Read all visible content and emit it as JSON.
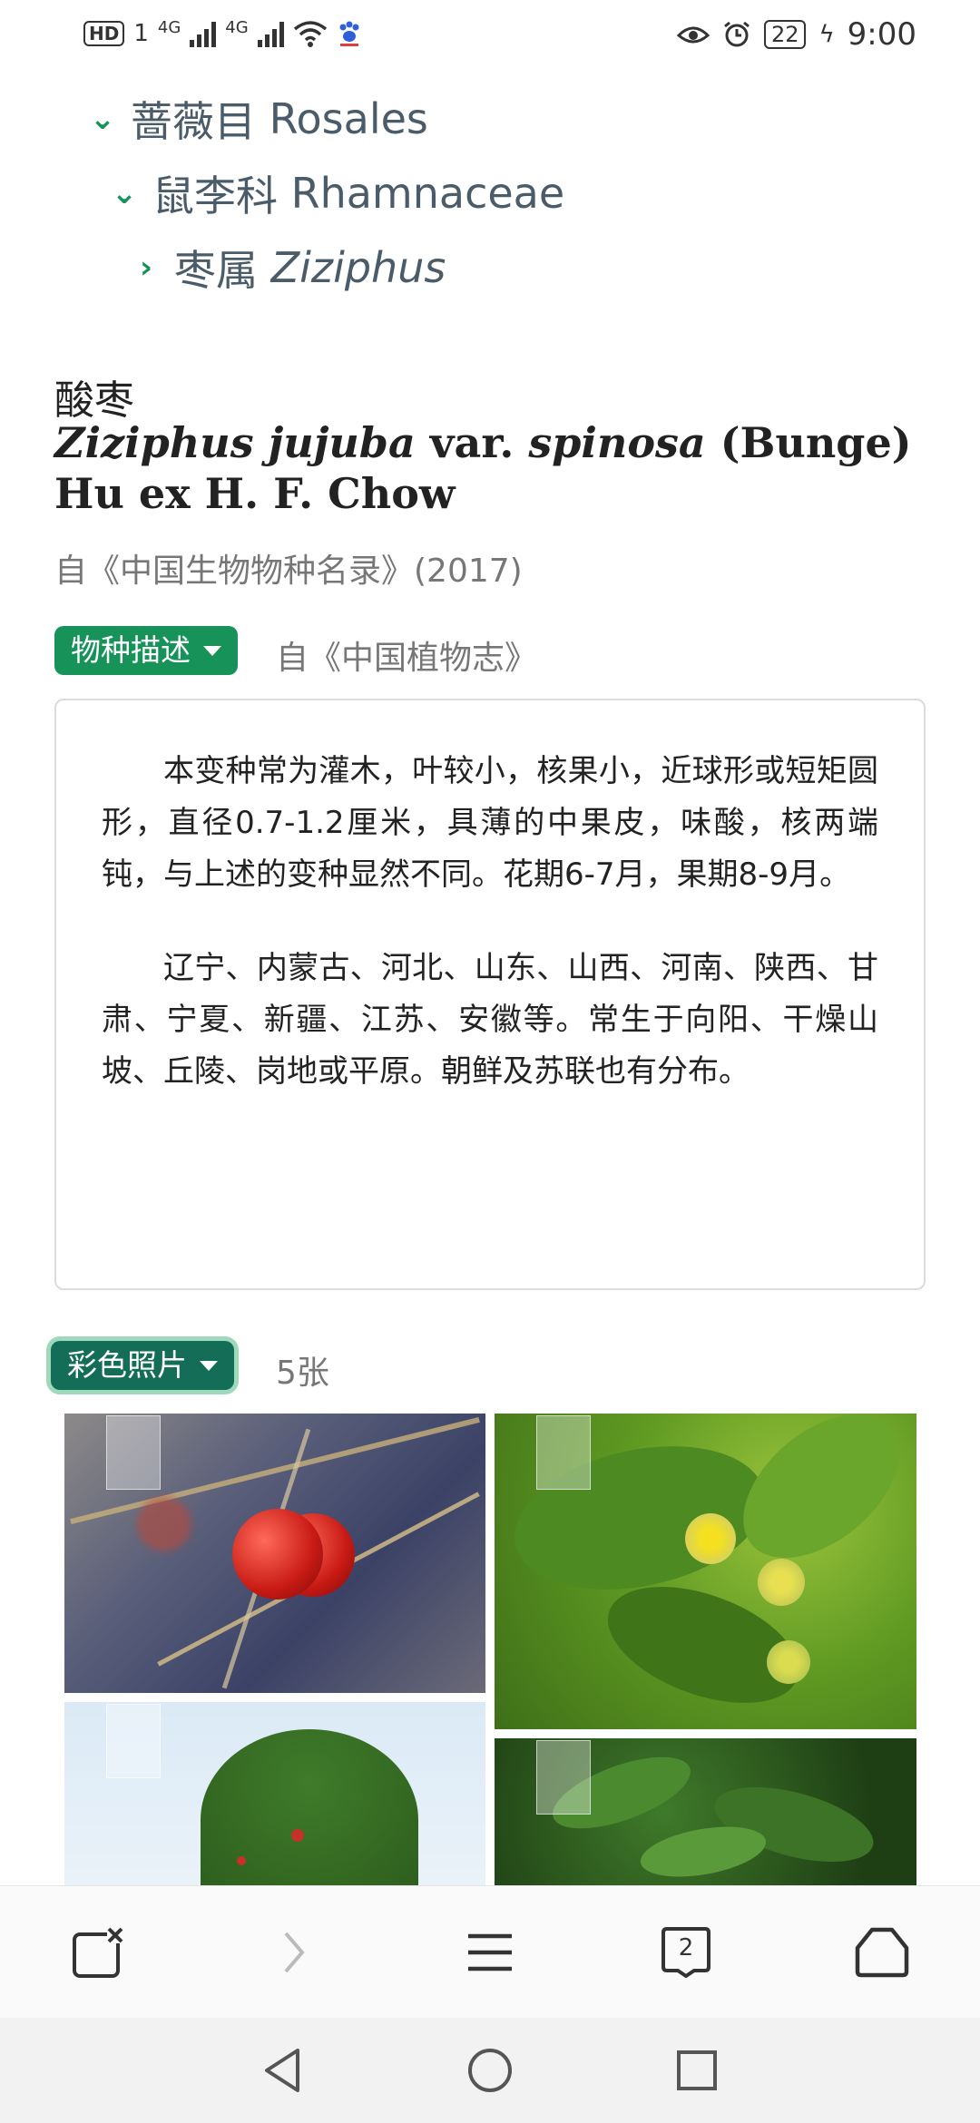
{
  "status_bar": {
    "left_labels": [
      "HD",
      "1",
      "4G",
      "4G"
    ],
    "battery": "22",
    "time": "9:00"
  },
  "taxonomy": [
    {
      "cn": "蔷薇目",
      "latin": "Rosales",
      "expanded": true,
      "italic": false
    },
    {
      "cn": "鼠李科",
      "latin": "Rhamnaceae",
      "expanded": true,
      "italic": false
    },
    {
      "cn": "枣属",
      "latin": "Ziziphus",
      "expanded": false,
      "italic": true
    }
  ],
  "species": {
    "chinese_name": "酸枣",
    "genus": "Ziziphus",
    "epithet": "jujuba",
    "rank": "var.",
    "infra_epithet": "spinosa",
    "authority": "(Bunge) Hu ex H. F. Chow",
    "source": "自《中国生物物种名录》(2017)"
  },
  "description": {
    "button_label": "物种描述",
    "source": "自《中国植物志》",
    "paragraphs": [
      "本变种常为灌木，叶较小，核果小，近球形或短矩圆形，直径0.7-1.2厘米，具薄的中果皮，味酸，核两端钝，与上述的变种显然不同。花期6-7月，果期8-9月。",
      "辽宁、内蒙古、河北、山东、山西、河南、陕西、甘肃、宁夏、新疆、江苏、安徽等。常生于向阳、干燥山坡、丘陵、岗地或平原。朝鲜及苏联也有分布。"
    ]
  },
  "photos": {
    "button_label": "彩色照片",
    "count": "5张",
    "items": [
      "red-jujube-fruit-photo",
      "yellow-flower-photo",
      "shrub-against-sky-photo",
      "green-foliage-photo"
    ]
  },
  "toolbar": {
    "items": [
      "close-tab-icon",
      "forward-icon",
      "menu-icon",
      "tabs-icon",
      "home-icon"
    ],
    "tab_count": "2"
  },
  "navbar": {
    "items": [
      "back-icon",
      "home-circle-icon",
      "recents-icon"
    ]
  },
  "colors": {
    "accent": "#17935a",
    "tree_text": "#4a5c6a",
    "muted_text": "#777777"
  }
}
